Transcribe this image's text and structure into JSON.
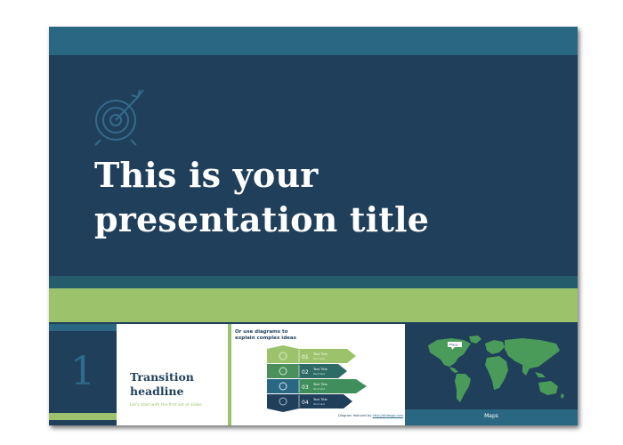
{
  "slide": {
    "title_lines": [
      "This is your",
      "presentation title"
    ],
    "icon": "target-arrow-icon"
  },
  "thumbnails": [
    {
      "number": "1",
      "headline_lines": [
        "Transition",
        "headline"
      ],
      "subtitle": "Let's start with the first set of slides"
    },
    {
      "heading_lines": [
        "Or use diagrams to",
        "explain complex ideas"
      ],
      "steps": [
        {
          "num": "01",
          "title": "Text Title",
          "text": "Short text"
        },
        {
          "num": "02",
          "title": "Text Title",
          "text": "Short text"
        },
        {
          "num": "03",
          "title": "Text Title",
          "text": "Short text"
        },
        {
          "num": "04",
          "title": "Text Title",
          "text": "Short text"
        }
      ],
      "footer_text": "Diagram featured by",
      "footer_link": "http://slidesgo.com"
    },
    {
      "label": "Maps",
      "map_callout": "Place"
    }
  ],
  "colors": {
    "navy": "#1f3f5b",
    "teal": "#2a6782",
    "green": "#9cc36b",
    "map_green": "#4a9a5a"
  }
}
